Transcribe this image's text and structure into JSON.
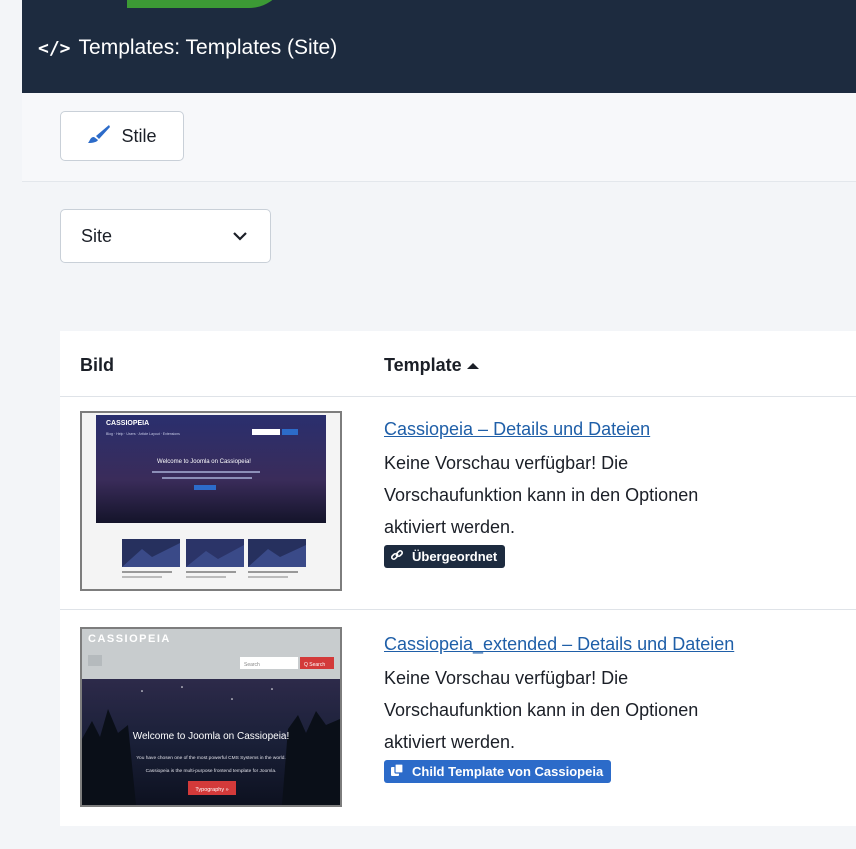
{
  "header": {
    "title": "Templates: Templates (Site)",
    "icon": "code-icon"
  },
  "toolbar": {
    "stile_label": "Stile",
    "stile_icon": "brush-icon"
  },
  "client_filter": {
    "selected": "Site"
  },
  "table": {
    "columns": {
      "image": "Bild",
      "template": "Template"
    },
    "sort": "ascending",
    "rows": [
      {
        "link": "Cassiopeia – Details und Dateien",
        "description": [
          "Keine Vorschau verfügbar! Die",
          "Vorschaufunktion kann in den Optionen",
          "aktiviert werden."
        ],
        "badge": "Übergeordnet",
        "badge_icon": "link-icon",
        "preview": {
          "brand": "CASSIOPEIA",
          "nav": [
            "Blog",
            "Help",
            "Users",
            "Article Layout",
            "Extensions"
          ],
          "search": "Search",
          "heading": "Welcome to Joomla on Cassiopeia!"
        }
      },
      {
        "link": "Cassiopeia_extended – Details und Dateien",
        "description": [
          "Keine Vorschau verfügbar! Die",
          "Vorschaufunktion kann in den Optionen",
          "aktiviert werden."
        ],
        "badge": "Child Template von Cassiopeia",
        "badge_icon": "copy-icon",
        "preview": {
          "brand": "CASSIOPEIA",
          "search_placeholder": "Search",
          "search_button": "Q Search",
          "heading": "Welcome to Joomla on Cassiopeia!",
          "line1": "You have chosen one of the most powerful CMS Systems in the world.",
          "line2": "Cassiopeia is the multi-purpose frontend template for Joomla.",
          "cta": "Typography »"
        }
      }
    ]
  },
  "colors": {
    "header_bg": "#1d2b3f",
    "accent_green": "#3c9a35",
    "link": "#1f5fa8",
    "badge_parent": "#1d2b3f",
    "badge_child": "#2c6bc9"
  }
}
